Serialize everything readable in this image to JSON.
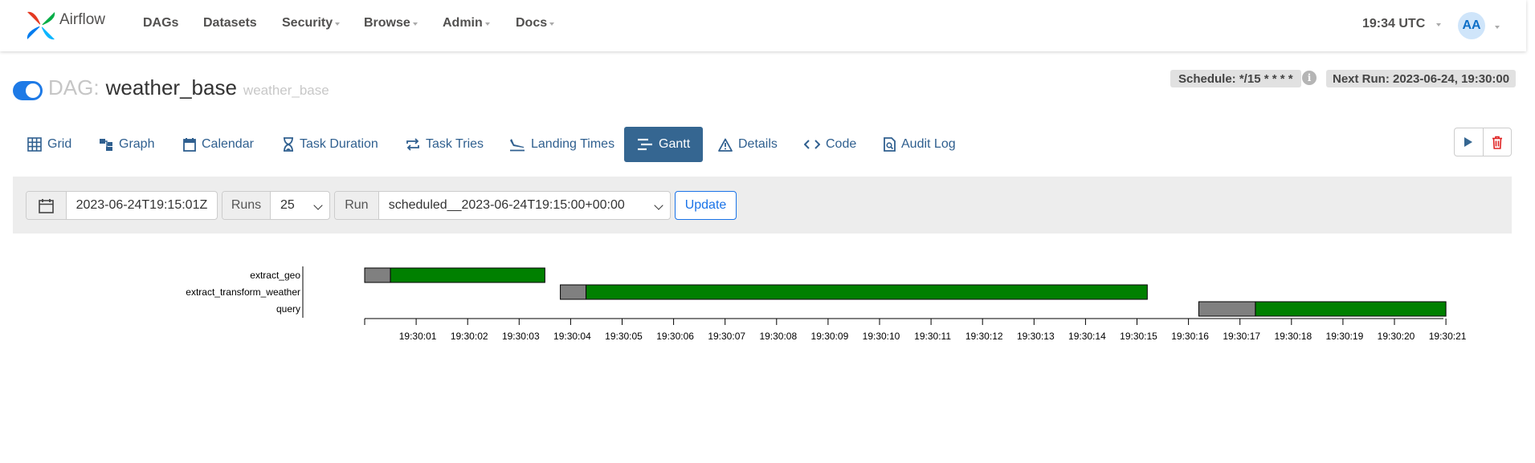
{
  "nav": {
    "brand": "Airflow",
    "items": [
      {
        "label": "DAGs",
        "dropdown": false
      },
      {
        "label": "Datasets",
        "dropdown": false
      },
      {
        "label": "Security",
        "dropdown": true
      },
      {
        "label": "Browse",
        "dropdown": true
      },
      {
        "label": "Admin",
        "dropdown": true
      },
      {
        "label": "Docs",
        "dropdown": true
      }
    ],
    "clock": "19:34 UTC",
    "avatar": "AA"
  },
  "dag": {
    "prefix": "DAG:",
    "name": "weather_base",
    "subtitle": "weather_base",
    "schedule": "Schedule: */15 * * * *",
    "next_run": "Next Run: 2023-06-24, 19:30:00",
    "paused": false
  },
  "tabs": [
    {
      "label": "Grid",
      "icon": "grid-icon",
      "active": false
    },
    {
      "label": "Graph",
      "icon": "graph-icon",
      "active": false
    },
    {
      "label": "Calendar",
      "icon": "calendar-icon",
      "active": false
    },
    {
      "label": "Task Duration",
      "icon": "hourglass-icon",
      "active": false
    },
    {
      "label": "Task Tries",
      "icon": "retry-icon",
      "active": false
    },
    {
      "label": "Landing Times",
      "icon": "landing-icon",
      "active": false
    },
    {
      "label": "Gantt",
      "icon": "gantt-icon",
      "active": true
    },
    {
      "label": "Details",
      "icon": "warning-triangle-icon",
      "active": false
    },
    {
      "label": "Code",
      "icon": "code-icon",
      "active": false
    },
    {
      "label": "Audit Log",
      "icon": "audit-log-icon",
      "active": false
    }
  ],
  "filters": {
    "base_date": "2023-06-24T19:15:01Z",
    "runs_label": "Runs",
    "runs_value": "25",
    "run_label": "Run",
    "run_value": "scheduled__2023-06-24T19:15:00+00:00",
    "update_label": "Update"
  },
  "gantt": {
    "tasks": [
      {
        "name": "extract_geo",
        "queued_start": "19:30:00.0",
        "start": "19:30:00.5",
        "end": "19:30:03.5",
        "state": "success"
      },
      {
        "name": "extract_transform_weather",
        "queued_start": "19:30:03.8",
        "start": "19:30:04.3",
        "end": "19:30:15.2",
        "state": "success"
      },
      {
        "name": "query",
        "queued_start": "19:30:16.2",
        "start": "19:30:17.3",
        "end": "19:30:21.0",
        "state": "success"
      }
    ],
    "ticks": [
      "19:30:01",
      "19:30:02",
      "19:30:03",
      "19:30:04",
      "19:30:05",
      "19:30:06",
      "19:30:07",
      "19:30:08",
      "19:30:09",
      "19:30:10",
      "19:30:11",
      "19:30:12",
      "19:30:13",
      "19:30:14",
      "19:30:15",
      "19:30:16",
      "19:30:17",
      "19:30:18",
      "19:30:19",
      "19:30:20",
      "19:30:21"
    ],
    "colors": {
      "success": "#008000",
      "queued": "#808080"
    }
  },
  "chart_data": {
    "type": "gantt",
    "x_unit": "seconds after 19:30:00",
    "xlim": [
      0,
      21
    ],
    "tasks": [
      {
        "name": "extract_geo",
        "queued": [
          0.0,
          0.5
        ],
        "running": [
          0.5,
          3.5
        ]
      },
      {
        "name": "extract_transform_weather",
        "queued": [
          3.8,
          4.3
        ],
        "running": [
          4.3,
          15.2
        ]
      },
      {
        "name": "query",
        "queued": [
          16.2,
          17.3
        ],
        "running": [
          17.3,
          21.0
        ]
      }
    ]
  }
}
